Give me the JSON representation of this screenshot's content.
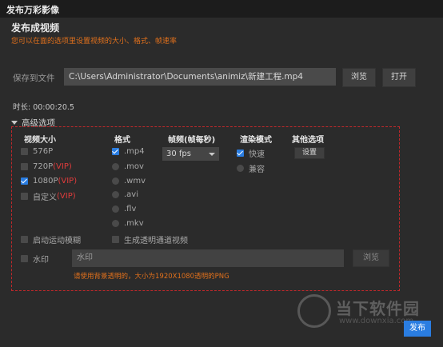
{
  "window": {
    "title": "发布万彩影像"
  },
  "header": {
    "title": "发布成视频",
    "hint": "您可以在面的选项里设置视频的大小、格式、帧速率"
  },
  "save": {
    "label": "保存到文件",
    "path_value": "C:\\Users\\Administrator\\Documents\\animiz\\新建工程.mp4",
    "browse_label": "浏览",
    "open_label": "打开"
  },
  "duration": {
    "text": "时长: 00:00:20.5"
  },
  "advanced": {
    "toggle_label": "高级选项",
    "size": {
      "heading": "视频大小",
      "options": [
        {
          "label": "576P",
          "vip": "",
          "checked": false
        },
        {
          "label": "720P",
          "vip": "(VIP)",
          "checked": false
        },
        {
          "label": "1080P",
          "vip": "(VIP)",
          "checked": true
        },
        {
          "label": "自定义",
          "vip": "(VIP)",
          "checked": false
        }
      ]
    },
    "format": {
      "heading": "格式",
      "options": [
        {
          "label": ".mp4",
          "checked": true
        },
        {
          "label": ".mov",
          "checked": false
        },
        {
          "label": ".wmv",
          "checked": false
        },
        {
          "label": ".avi",
          "checked": false
        },
        {
          "label": ".flv",
          "checked": false
        },
        {
          "label": ".mkv",
          "checked": false
        }
      ]
    },
    "fps": {
      "heading": "帧频(帧每秒)",
      "value": "30 fps"
    },
    "render": {
      "heading": "渲染模式",
      "options": [
        {
          "label": "快速",
          "checked": true
        },
        {
          "label": "兼容",
          "checked": false
        }
      ]
    },
    "other": {
      "heading": "其他选项",
      "settings_label": "设置"
    },
    "motion_blur_label": "启动运动模糊",
    "transparent_label": "生成透明通道视频",
    "watermark": {
      "label": "水印",
      "input_value": "水印",
      "browse_label": "浏览",
      "warning": "请使用背景透明的，大小为1920X1080透明的PNG"
    }
  },
  "footer": {
    "publish_label": "发布"
  },
  "site_watermark": {
    "brand": "当下软件园",
    "url": "www.downxia.com"
  },
  "colors": {
    "accent": "#2a7de1",
    "warning": "#e0701c",
    "border": "#c0282b"
  }
}
